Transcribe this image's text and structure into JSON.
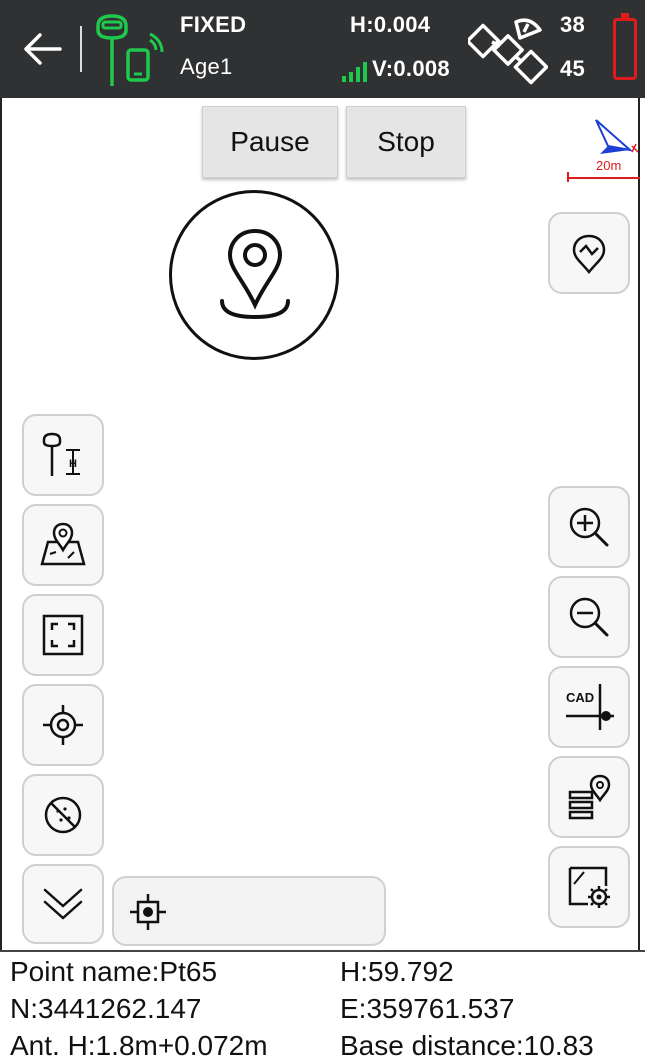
{
  "status": {
    "solution": "FIXED",
    "age": "Age1",
    "h_precision": "H:0.004",
    "v_precision": "V:0.008",
    "sats_used": "38",
    "sats_tracked": "45"
  },
  "controls": {
    "pause_label": "Pause",
    "stop_label": "Stop"
  },
  "scale": {
    "label": "20m"
  },
  "info": {
    "point_name": "Point name:Pt65",
    "height": "H:59.792",
    "north": "N:3441262.147",
    "east": "E:359761.537",
    "antenna": "Ant. H:1.8m+0.072m",
    "base_distance": "Base distance:10.83"
  },
  "colors": {
    "topbar": "#2f3133",
    "accent_green": "#1ec94b",
    "battery_red": "#e01b1b",
    "compass_blue": "#1d3fd6",
    "scale_red": "#e01b1b"
  },
  "icons": {
    "left_tools": [
      "antenna-height-icon",
      "map-point-icon",
      "fullscreen-icon",
      "locate-icon",
      "hide-points-icon",
      "expand-down-icon"
    ],
    "right_tools": [
      "path-point-icon",
      "zoom-in-icon",
      "zoom-out-icon",
      "cad-icon",
      "layer-points-icon",
      "map-settings-icon"
    ]
  }
}
